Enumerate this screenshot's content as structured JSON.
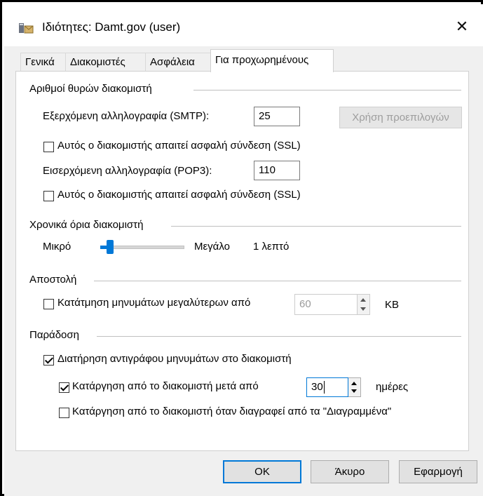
{
  "window": {
    "title": "Ιδιότητες: Damt.gov (user)",
    "close": "✕"
  },
  "tabs": [
    "Γενικά",
    "Διακομιστές",
    "Ασφάλεια",
    "Για προχωρημένους"
  ],
  "ports": {
    "group_label": "Αριθμοί θυρών διακομιστή",
    "smtp_label": "Εξερχόμενη αλληλογραφία (SMTP):",
    "smtp_value": "25",
    "defaults_button": "Χρήση προεπιλογών",
    "smtp_ssl_label": "Αυτός ο διακομιστής απαιτεί ασφαλή σύνδεση (SSL)",
    "smtp_ssl_checked": false,
    "pop3_label": "Εισερχόμενη αλληλογραφία (POP3):",
    "pop3_value": "110",
    "pop3_ssl_label": "Αυτός ο διακομιστής απαιτεί ασφαλή σύνδεση (SSL)",
    "pop3_ssl_checked": false
  },
  "timeouts": {
    "group_label": "Χρονικά όρια διακομιστή",
    "short_label": "Μικρό",
    "long_label": "Μεγάλο",
    "value_label": "1 λεπτό",
    "slider_level": 0.12
  },
  "sending": {
    "group_label": "Αποστολή",
    "split_label": "Κατάτμηση μηνυμάτων μεγαλύτερων από",
    "split_checked": false,
    "split_value": "60",
    "split_unit": "KB"
  },
  "delivery": {
    "group_label": "Παράδοση",
    "leave_copy_label": "Διατήρηση αντιγράφου μηνυμάτων στο διακομιστή",
    "leave_copy_checked": true,
    "remove_after_label": "Κατάργηση από το διακομιστή μετά από",
    "remove_after_checked": true,
    "remove_after_value": "30",
    "remove_after_unit": "ημέρες",
    "remove_deleted_label": "Κατάργηση από το διακομιστή όταν διαγραφεί από τα \"Διαγραμμένα\"",
    "remove_deleted_checked": false
  },
  "buttons": {
    "ok": "OK",
    "cancel": "Άκυρο",
    "apply": "Εφαρμογή"
  }
}
